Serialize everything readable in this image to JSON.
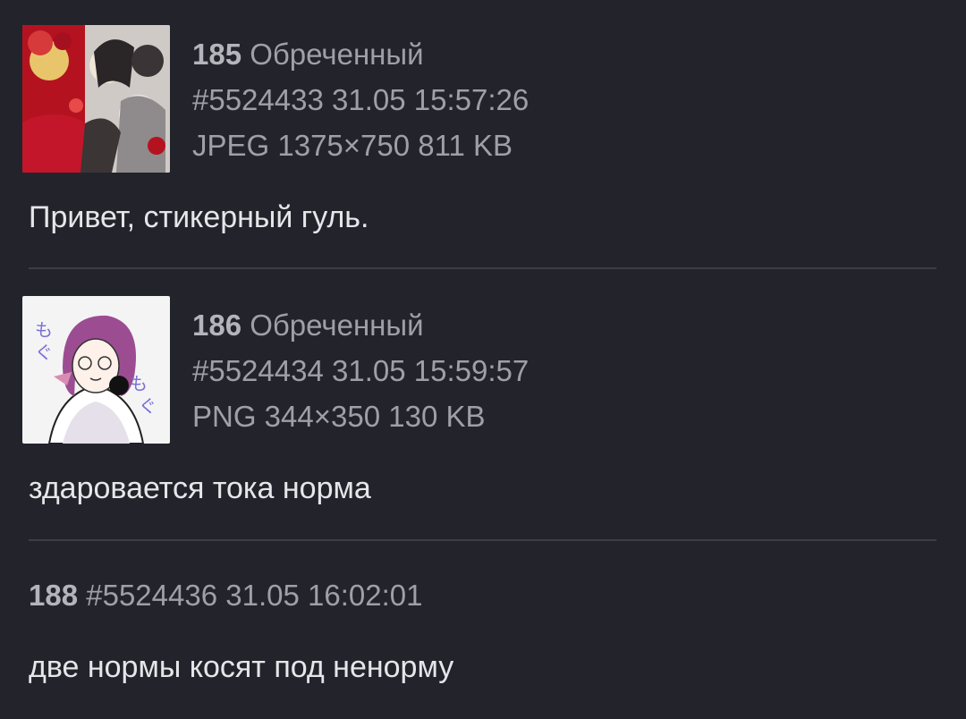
{
  "posts": [
    {
      "number": "185",
      "name": "Обреченный",
      "post_id": "#5524433",
      "datetime": "31.05 15:57:26",
      "file_info": "JPEG 1375×750 811 KB",
      "thumbnail": "anime-art-thumbnail",
      "text": "Привет, стикерный гуль."
    },
    {
      "number": "186",
      "name": "Обреченный",
      "post_id": "#5524434",
      "datetime": "31.05 15:59:57",
      "file_info": "PNG 344×350 130 KB",
      "thumbnail": "sticker-thumbnail",
      "text": "здаровается тока норма"
    },
    {
      "number": "188",
      "post_id": "#5524436",
      "datetime": "31.05 16:02:01",
      "text": "две нормы косят под ненорму"
    }
  ],
  "colors": {
    "background": "#23232b",
    "meta_text": "#9fa0a6",
    "body_text": "#e6e6ea",
    "divider": "#3d3d45"
  }
}
